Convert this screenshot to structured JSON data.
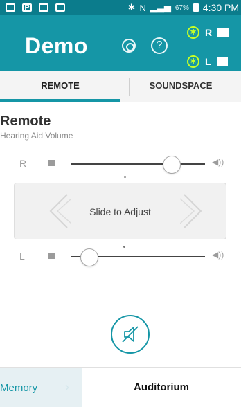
{
  "status_bar": {
    "time": "4:30 PM",
    "battery": "67%"
  },
  "header": {
    "title": "Demo",
    "right_indicator": "R",
    "left_indicator": "L"
  },
  "tabs": [
    {
      "label": "REMOTE",
      "active": true
    },
    {
      "label": "SOUNDSPACE",
      "active": false
    }
  ],
  "remote": {
    "title": "Remote",
    "subtitle": "Hearing Aid Volume",
    "right": {
      "label": "R",
      "level": 0.75
    },
    "left": {
      "label": "L",
      "level": 0.14
    },
    "slide_text": "Slide to Adjust"
  },
  "bottom_bar": {
    "memory_label": "Memory",
    "program_label": "Auditorium"
  },
  "colors": {
    "teal": "#1596a6",
    "status_bar": "#0b7c8c",
    "bluetooth": "#c6ff26"
  }
}
